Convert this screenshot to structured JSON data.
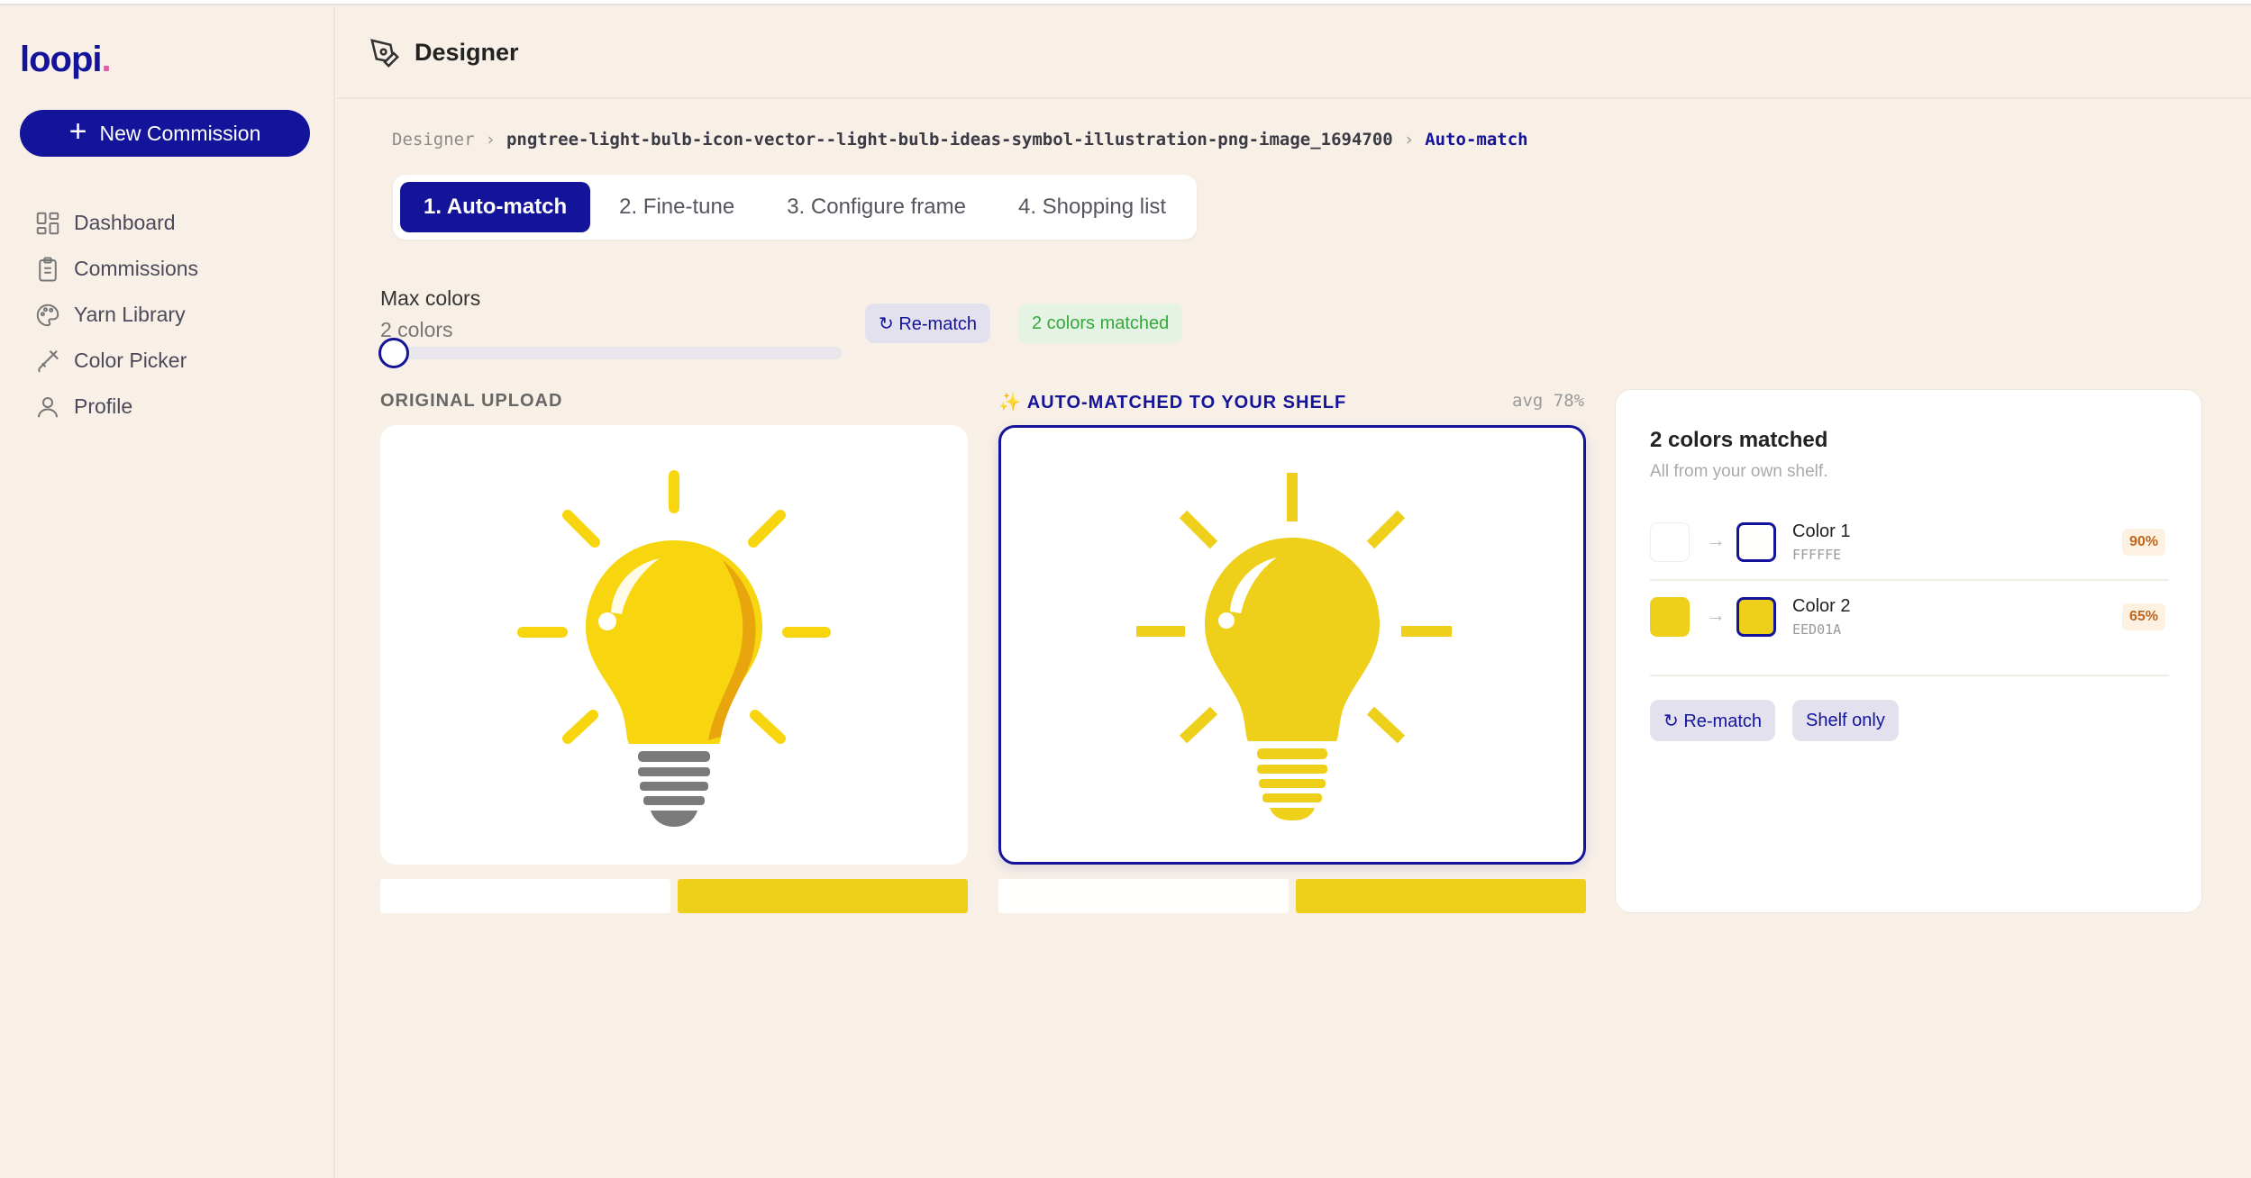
{
  "app": {
    "logo": "loopi",
    "logo_dot": "."
  },
  "sidebar": {
    "new_button": "New Commission",
    "items": [
      {
        "label": "Dashboard",
        "icon": "grid-icon"
      },
      {
        "label": "Commissions",
        "icon": "clipboard-icon"
      },
      {
        "label": "Yarn Library",
        "icon": "palette-icon"
      },
      {
        "label": "Color Picker",
        "icon": "brush-icon"
      },
      {
        "label": "Profile",
        "icon": "user-icon"
      }
    ]
  },
  "header": {
    "title": "Designer",
    "icon": "pen-tool-icon"
  },
  "breadcrumb": {
    "root": "Designer",
    "file": "pngtree-light-bulb-icon-vector--light-bulb-ideas-symbol-illustration-png-image_1694700",
    "current": "Auto-match",
    "separator": "›"
  },
  "tabs": [
    {
      "label": "1. Auto-match",
      "active": true
    },
    {
      "label": "2. Fine-tune",
      "active": false
    },
    {
      "label": "3. Configure frame",
      "active": false
    },
    {
      "label": "4. Shopping list",
      "active": false
    }
  ],
  "controls": {
    "max_colors_label": "Max colors",
    "max_colors_value": "2 colors",
    "slider_value": 2,
    "rematch_label": "↻ Re-match",
    "matched_label": "2 colors matched"
  },
  "preview": {
    "original_label": "ORIGINAL UPLOAD",
    "auto_label": "✨ AUTO-MATCHED TO YOUR SHELF",
    "avg_label": "avg 78%"
  },
  "palette_bars": {
    "original": [
      "#FFFFFF",
      "#EED01A"
    ],
    "matched": [
      "#FFFFFE",
      "#EED01A"
    ]
  },
  "panel": {
    "title": "2 colors matched",
    "subtitle": "All from your own shelf.",
    "colors": [
      {
        "name": "Color 1",
        "hex": "FFFFFE",
        "source": "#FFFFFF",
        "match": "#FFFFFE",
        "pct": "90%"
      },
      {
        "name": "Color 2",
        "hex": "EED01A",
        "source": "#EED01A",
        "match": "#EED01A",
        "pct": "65%"
      }
    ],
    "rematch_label": "↻ Re-match",
    "shelf_only_label": "Shelf only"
  },
  "colors": {
    "brand": "#14149A",
    "background": "#F8F0E7",
    "bulb_yellow": "#F7D60F",
    "matched_yellow": "#EED01A"
  }
}
